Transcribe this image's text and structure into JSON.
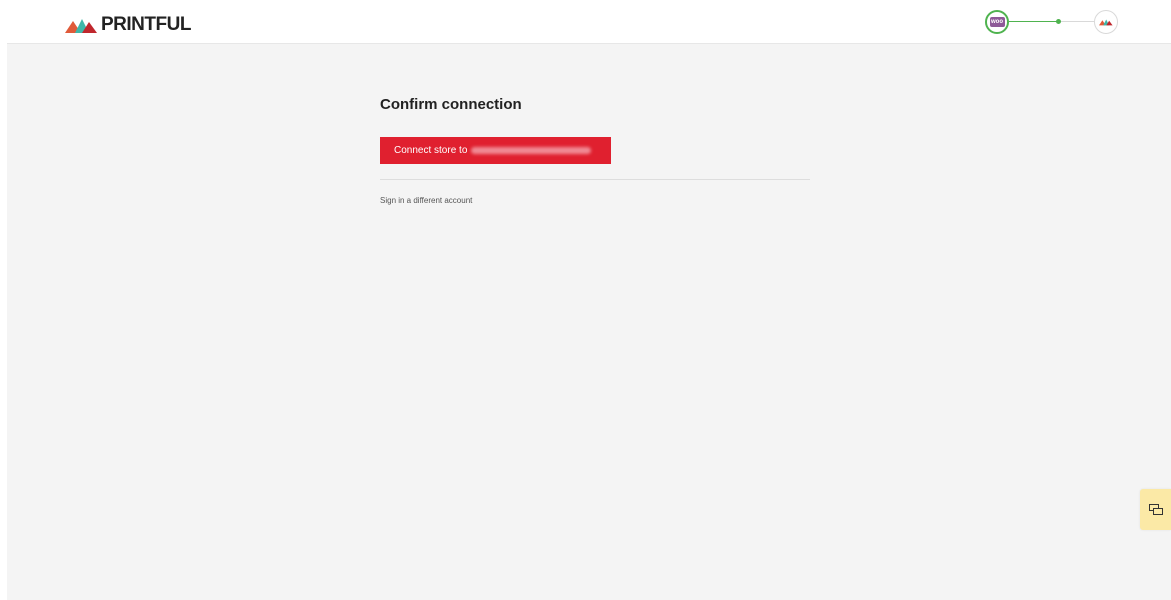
{
  "brand": {
    "name": "PRINTFUL",
    "colors": {
      "primary_red": "#e0202f",
      "dark_red": "#d64a3a",
      "teal": "#3fb7a9",
      "dark": "#222222"
    }
  },
  "progress": {
    "step_from_icon": "woocommerce-icon",
    "step_from_badge": "woo",
    "step_to_icon": "printful-logo-icon",
    "accent_color": "#4fb34f"
  },
  "main": {
    "title": "Confirm connection",
    "connect_button_label": "Connect store to",
    "connect_button_email": "redacted",
    "alt_link": "Sign in a different account"
  },
  "chat": {
    "icon": "chat-icon",
    "color": "#fbe9a6"
  }
}
